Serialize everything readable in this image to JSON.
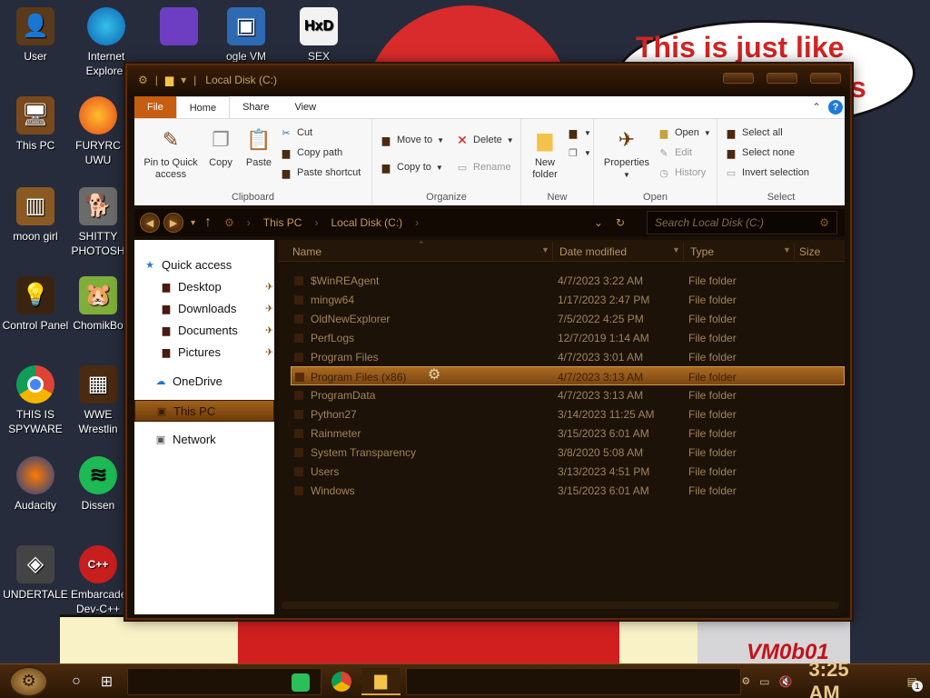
{
  "wallpaper": {
    "bubble_text_line1": "This is just like",
    "bubble_text_line2": "s",
    "watermark": "VM0b01"
  },
  "desktop": {
    "icons": [
      {
        "label": "User",
        "icon": "user-folder-icon"
      },
      {
        "label": "Internet\nExplorer",
        "icon": "edge-icon"
      },
      {
        "label": "",
        "icon": "visual-studio-icon"
      },
      {
        "label": "ogle VM",
        "icon": "virtualbox-icon"
      },
      {
        "label": "SEX",
        "icon": "hxd-icon"
      },
      {
        "label": "This PC",
        "icon": "computer-icon"
      },
      {
        "label": "FURYRC\nUWU",
        "icon": "firefox-icon"
      },
      {
        "label": "moon girl",
        "icon": "folder-icon"
      },
      {
        "label": "SHITTY\nPHOTOSH",
        "icon": "gimp-icon"
      },
      {
        "label": "Control Panel",
        "icon": "control-panel-icon"
      },
      {
        "label": "ChomikBo",
        "icon": "hamster-icon"
      },
      {
        "label": "THIS IS\nSPYWARE",
        "icon": "chrome-icon"
      },
      {
        "label": "WWE\nWrestlin",
        "icon": "wwe-icon"
      },
      {
        "label": "Audacity",
        "icon": "audacity-icon"
      },
      {
        "label": "Dissen",
        "icon": "spotify-icon"
      },
      {
        "label": "UNDERTALE",
        "icon": "unity-icon"
      },
      {
        "label": "Embarcade\nDev-C++",
        "icon": "devcpp-icon"
      }
    ]
  },
  "window": {
    "title": "Local Disk (C:)",
    "tabs": {
      "file": "File",
      "home": "Home",
      "share": "Share",
      "view": "View"
    },
    "ribbon": {
      "clipboard": {
        "group": "Clipboard",
        "pin": "Pin to Quick\naccess",
        "copy": "Copy",
        "paste": "Paste",
        "cut": "Cut",
        "copy_path": "Copy path",
        "paste_shortcut": "Paste shortcut"
      },
      "organize": {
        "group": "Organize",
        "move_to": "Move to",
        "copy_to": "Copy to",
        "delete": "Delete",
        "rename": "Rename"
      },
      "new": {
        "group": "New",
        "new_folder": "New\nfolder"
      },
      "open": {
        "group": "Open",
        "properties": "Properties",
        "open": "Open",
        "edit": "Edit",
        "history": "History"
      },
      "select": {
        "group": "Select",
        "select_all": "Select all",
        "select_none": "Select none",
        "invert": "Invert selection"
      }
    },
    "address": {
      "crumbs": [
        "This PC",
        "Local Disk (C:)"
      ],
      "search_placeholder": "Search Local Disk (C:)"
    },
    "nav": {
      "quick_access": "Quick access",
      "desktop": "Desktop",
      "downloads": "Downloads",
      "documents": "Documents",
      "pictures": "Pictures",
      "onedrive": "OneDrive",
      "this_pc": "This PC",
      "network": "Network"
    },
    "columns": {
      "name": "Name",
      "date": "Date modified",
      "type": "Type",
      "size": "Size"
    },
    "files": [
      {
        "name": "$WinREAgent",
        "date": "4/7/2023 3:22 AM",
        "type": "File folder"
      },
      {
        "name": "mingw64",
        "date": "1/17/2023 2:47 PM",
        "type": "File folder"
      },
      {
        "name": "OldNewExplorer",
        "date": "7/5/2022 4:25 PM",
        "type": "File folder"
      },
      {
        "name": "PerfLogs",
        "date": "12/7/2019 1:14 AM",
        "type": "File folder"
      },
      {
        "name": "Program Files",
        "date": "4/7/2023 3:01 AM",
        "type": "File folder"
      },
      {
        "name": "Program Files (x86)",
        "date": "4/7/2023 3:13 AM",
        "type": "File folder",
        "selected": true
      },
      {
        "name": "ProgramData",
        "date": "4/7/2023 3:13 AM",
        "type": "File folder"
      },
      {
        "name": "Python27",
        "date": "3/14/2023 11:25 AM",
        "type": "File folder"
      },
      {
        "name": "Rainmeter",
        "date": "3/15/2023 6:01 AM",
        "type": "File folder"
      },
      {
        "name": "System Transparency",
        "date": "3/8/2020 5:08 AM",
        "type": "File folder"
      },
      {
        "name": "Users",
        "date": "3/13/2023 4:51 PM",
        "type": "File folder"
      },
      {
        "name": "Windows",
        "date": "3/15/2023 6:01 AM",
        "type": "File folder"
      }
    ]
  },
  "taskbar": {
    "clock": "3:25 AM",
    "notification_count": "1"
  },
  "colors": {
    "accent": "#c65d10",
    "window_bg": "#1b1007",
    "file_text": "#a28459",
    "selection": "#a96a22"
  }
}
